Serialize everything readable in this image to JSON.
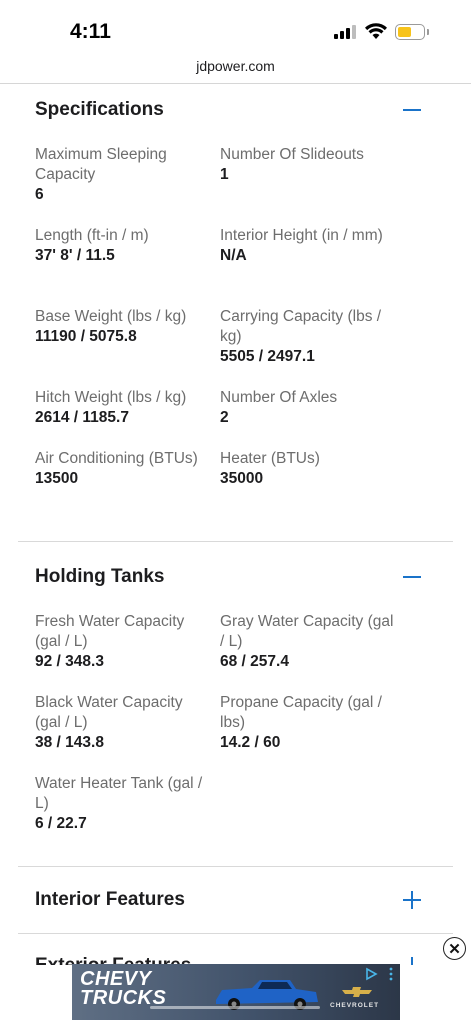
{
  "status_bar": {
    "time": "4:11"
  },
  "browser": {
    "url": "jdpower.com"
  },
  "sections": {
    "specifications": {
      "title": "Specifications",
      "toggle": "collapse",
      "items": [
        {
          "label": "Maximum Sleeping Capacity",
          "value": "6"
        },
        {
          "label": "Number Of Slideouts",
          "value": "1"
        },
        {
          "label": "Length (ft-in / m)",
          "value": "37' 8' / 11.5"
        },
        {
          "label": "Interior Height (in / mm)",
          "value": "N/A"
        },
        {
          "label": "Base Weight (lbs / kg)",
          "value": "11190 / 5075.8"
        },
        {
          "label": "Carrying Capacity (lbs / kg)",
          "value": "5505 / 2497.1"
        },
        {
          "label": "Hitch Weight (lbs / kg)",
          "value": "2614 / 1185.7"
        },
        {
          "label": "Number Of Axles",
          "value": "2"
        },
        {
          "label": "Air Conditioning (BTUs)",
          "value": "13500"
        },
        {
          "label": "Heater (BTUs)",
          "value": "35000"
        }
      ]
    },
    "holding_tanks": {
      "title": "Holding Tanks",
      "toggle": "collapse",
      "items": [
        {
          "label": "Fresh Water Capacity (gal / L)",
          "value": "92 / 348.3"
        },
        {
          "label": "Gray Water Capacity (gal / L)",
          "value": "68 / 257.4"
        },
        {
          "label": "Black Water Capacity (gal / L)",
          "value": "38 / 143.8"
        },
        {
          "label": "Propane Capacity (gal / lbs)",
          "value": "14.2 / 60"
        },
        {
          "label": "Water Heater Tank (gal / L)",
          "value": "6 / 22.7"
        }
      ]
    },
    "interior_features": {
      "title": "Interior Features",
      "toggle": "expand"
    },
    "exterior_features": {
      "title": "Exterior Features",
      "toggle": "expand"
    }
  },
  "ad": {
    "line1": "CHEVY",
    "line2": "TRUCKS",
    "brand": "CHEVROLET",
    "close_glyph": "✕"
  },
  "colors": {
    "accent": "#1a73c9",
    "battery": "#f7c31a",
    "label": "#6d6d6d",
    "value": "#1d1d1f"
  }
}
